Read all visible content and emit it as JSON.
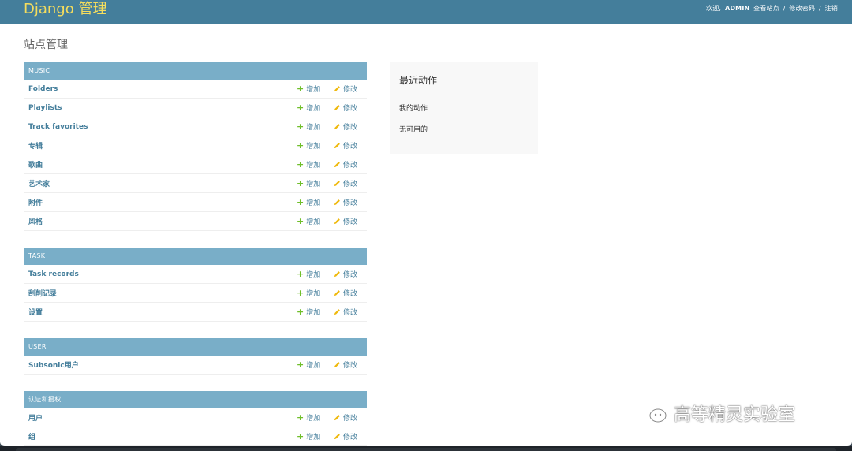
{
  "header": {
    "branding": "Django 管理",
    "welcome": "欢迎,",
    "user_name": "ADMIN",
    "view_site": "查看站点",
    "change_password": "修改密码",
    "logout": "注销",
    "separator": "/"
  },
  "page": {
    "title": "站点管理"
  },
  "actions": {
    "add_label": "增加",
    "change_label": "修改"
  },
  "modules": [
    {
      "caption": "MUSIC",
      "rows": [
        "Folders",
        "Playlists",
        "Track favorites",
        "专辑",
        "歌曲",
        "艺术家",
        "附件",
        "风格"
      ]
    },
    {
      "caption": "TASK",
      "rows": [
        "Task records",
        "刮削记录",
        "设置"
      ]
    },
    {
      "caption": "USER",
      "rows": [
        "Subsonic用户"
      ]
    },
    {
      "caption": "认证和授权",
      "rows": [
        "用户",
        "组"
      ]
    }
  ],
  "recent_actions": {
    "title": "最近动作",
    "my_actions": "我的动作",
    "none_available": "无可用的"
  },
  "watermark": {
    "text": "高等精灵实验室"
  },
  "colors": {
    "header_bg": "#447e9b",
    "branding": "#f5dd5d",
    "module_caption_bg": "#79aec8",
    "link": "#447e9b",
    "add_icon": "#70bf2b",
    "change_icon": "#efb80b"
  }
}
